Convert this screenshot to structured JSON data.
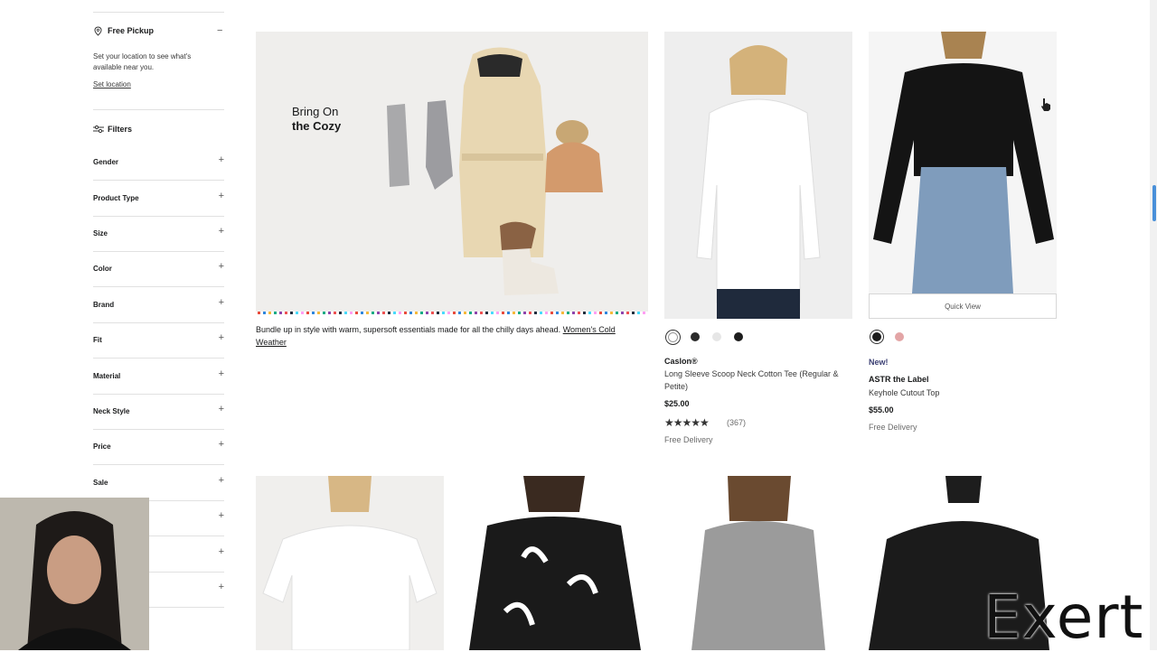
{
  "pickup": {
    "title": "Free Pickup",
    "description": "Set your location to see what's available near you.",
    "set_location": "Set location"
  },
  "filters": {
    "title": "Filters",
    "items": [
      {
        "label": "Gender"
      },
      {
        "label": "Product Type"
      },
      {
        "label": "Size"
      },
      {
        "label": "Color"
      },
      {
        "label": "Brand"
      },
      {
        "label": "Fit"
      },
      {
        "label": "Material"
      },
      {
        "label": "Neck Style"
      },
      {
        "label": "Price"
      },
      {
        "label": "Sale"
      }
    ]
  },
  "promo": {
    "title_line1": "Bring On",
    "title_line2": "the Cozy",
    "description": "Bundle up in style with warm, supersoft essentials made for all the chilly days ahead.",
    "link": "Women's Cold Weather"
  },
  "products": [
    {
      "brand": "Caslon®",
      "name": "Long Sleeve Scoop Neck Cotton Tee (Regular & Petite)",
      "price": "$25.00",
      "rating": 4.5,
      "review_count": "(367)",
      "delivery": "Free Delivery",
      "swatches": [
        "#ffffff",
        "#2b2b2b",
        "#e6e6e6",
        "#1d1d1d"
      ]
    },
    {
      "badge": "New!",
      "brand": "ASTR the Label",
      "name": "Keyhole Cutout Top",
      "price": "$55.00",
      "delivery": "Free Delivery",
      "quick_view": "Quick View",
      "swatches": [
        "#1c1c1c",
        "#e3a5a6"
      ]
    }
  ],
  "watermark": "Exert",
  "colors": {
    "accent_new": "#3b3f73",
    "sidebar_border": "#e1e1e1"
  }
}
